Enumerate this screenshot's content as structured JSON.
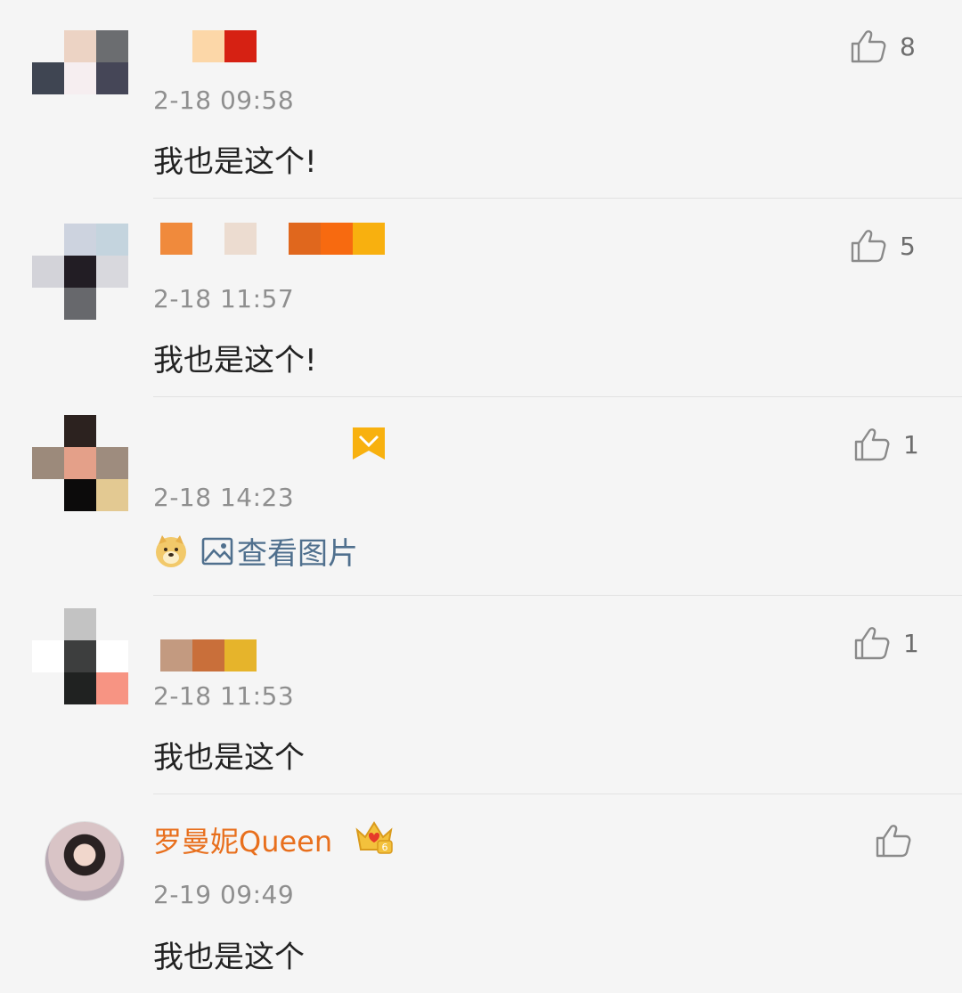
{
  "comments": [
    {
      "timestamp": "2-18 09:58",
      "likes": "8",
      "text": "我也是这个!",
      "avatar_icon": "blurred-avatar",
      "name_icon": "blurred-username"
    },
    {
      "timestamp": "2-18 11:57",
      "likes": "5",
      "text": "我也是这个!",
      "avatar_icon": "blurred-avatar",
      "name_icon": "blurred-username"
    },
    {
      "timestamp": "2-18 14:23",
      "likes": "1",
      "image_link_label": "查看图片",
      "emoji_icon": "doge-emoji-icon",
      "avatar_icon": "blurred-avatar",
      "name_icon": "blurred-username"
    },
    {
      "timestamp": "2-18 11:53",
      "likes": "1",
      "text": "我也是这个",
      "avatar_icon": "blurred-avatar",
      "name_icon": "blurred-username"
    },
    {
      "username": "罗曼妮Queen",
      "timestamp": "2-19 09:49",
      "likes": "",
      "text": "我也是这个",
      "badge_icon": "crown-level-badge",
      "badge_level": "6"
    }
  ],
  "colors": {
    "username": "#e86f1d",
    "timestamp": "#8f8f8f",
    "link": "#50708e",
    "background": "#f5f5f5"
  }
}
